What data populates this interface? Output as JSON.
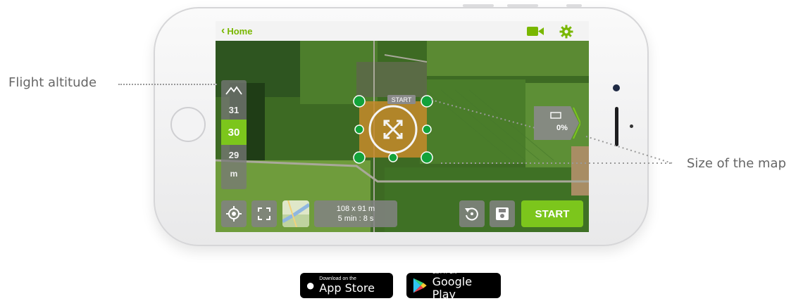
{
  "app": {
    "back_label": "Home",
    "altitude": {
      "options": [
        "31",
        "30",
        "29"
      ],
      "selected": "30",
      "unit": "m"
    },
    "map_size_percent": "0%",
    "start_marker": "START",
    "area": {
      "dimensions": "108 x 91 m",
      "duration": "5 min : 8 s"
    },
    "start_button": "START"
  },
  "annotations": {
    "flight_altitude": "Flight altitude",
    "map_size": "Size of the map"
  },
  "stores": {
    "apple": {
      "line1": "Download on the",
      "line2": "App Store"
    },
    "google": {
      "line1": "GET IT ON",
      "line2": "Google Play"
    }
  },
  "colors": {
    "accent": "#7cc61c",
    "panel": "#828282"
  }
}
